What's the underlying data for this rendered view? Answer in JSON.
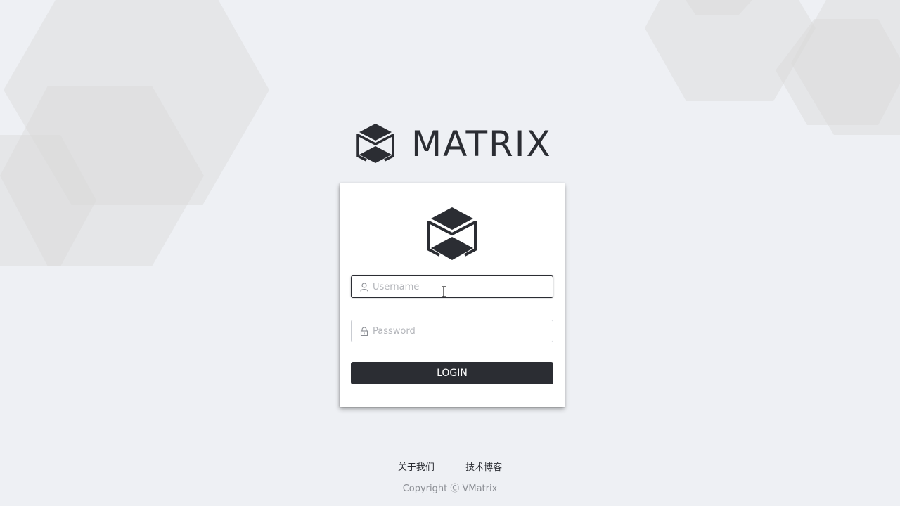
{
  "brand": {
    "name": "MATRIX",
    "logo_icon": "cube-logo-icon"
  },
  "login_form": {
    "username": {
      "placeholder": "Username",
      "value": "",
      "icon": "user-icon"
    },
    "password": {
      "placeholder": "Password",
      "value": "",
      "icon": "lock-icon"
    },
    "submit_label": "LOGIN"
  },
  "footer": {
    "links": [
      "关于我们",
      "技术博客"
    ],
    "copyright": "Copyright Ⓒ VMatrix"
  },
  "colors": {
    "background": "#eef0f4",
    "primary": "#2b2d33",
    "card": "#ffffff",
    "hexagon": "#dcdcdc"
  }
}
